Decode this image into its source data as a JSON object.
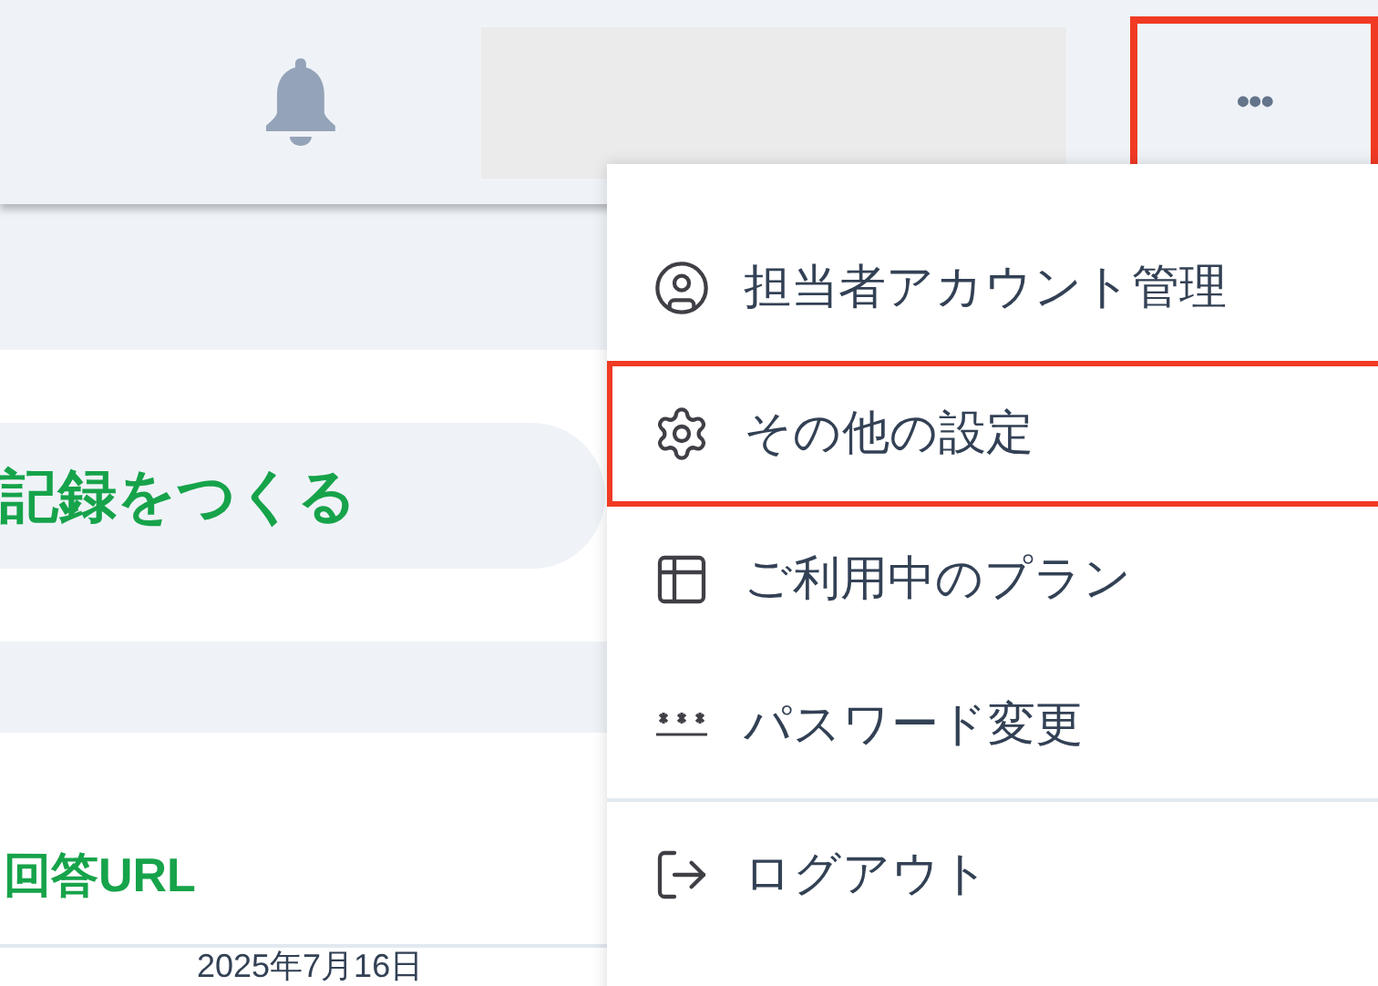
{
  "header": {
    "more_button": {
      "label": "•••",
      "highlighted": true
    }
  },
  "main": {
    "create_button": {
      "label": "記録をつくる"
    },
    "answer_url_link": {
      "label": "回答URL"
    },
    "date": "2025年7月16日"
  },
  "menu": {
    "items": [
      {
        "kind": "account",
        "label": "担当者アカウント管理",
        "highlighted": false
      },
      {
        "kind": "settings",
        "label": "その他の設定",
        "highlighted": true
      },
      {
        "kind": "plan",
        "label": "ご利用中のプラン",
        "highlighted": false
      },
      {
        "kind": "password",
        "label": "パスワード変更",
        "highlighted": false
      },
      {
        "kind": "logout",
        "label": "ログアウト",
        "highlighted": false
      }
    ]
  }
}
